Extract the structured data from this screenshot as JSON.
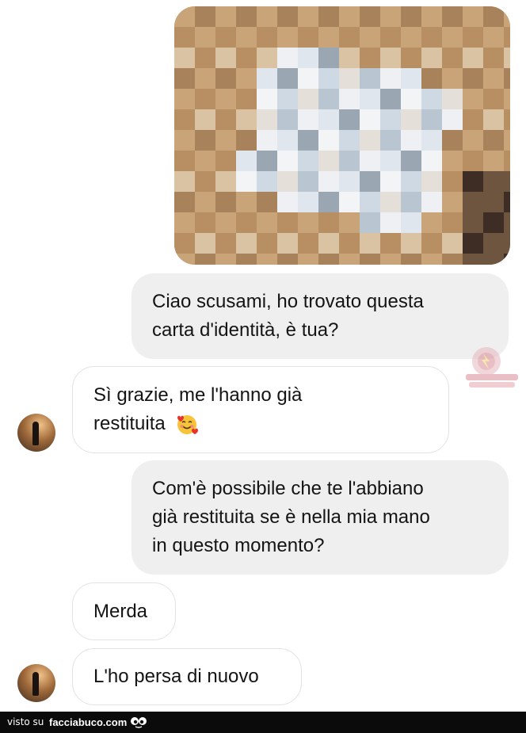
{
  "chat": {
    "messages": [
      {
        "direction": "outgoing",
        "lines": [
          "Ciao scusami, ho trovato questa",
          "carta d'identità, è tua?"
        ]
      },
      {
        "direction": "incoming",
        "lines": [
          "Sì grazie, me l'hanno già",
          "restituita"
        ],
        "emoji": "smiling-face-with-hearts"
      },
      {
        "direction": "outgoing",
        "lines": [
          "Com'è possibile che te l'abbiano",
          "già restituita se è nella mia mano",
          "in questo momento?"
        ]
      },
      {
        "direction": "incoming",
        "lines": [
          "Merda"
        ]
      },
      {
        "direction": "incoming",
        "lines": [
          "L'ho persa di nuovo"
        ]
      }
    ]
  },
  "footer": {
    "prefix": "visto su",
    "site": "facciabuco.com"
  },
  "colors": {
    "outgoing_bubble": "#efefef",
    "incoming_border": "#e3e3e3",
    "footer_bg": "#0b0b0b"
  }
}
